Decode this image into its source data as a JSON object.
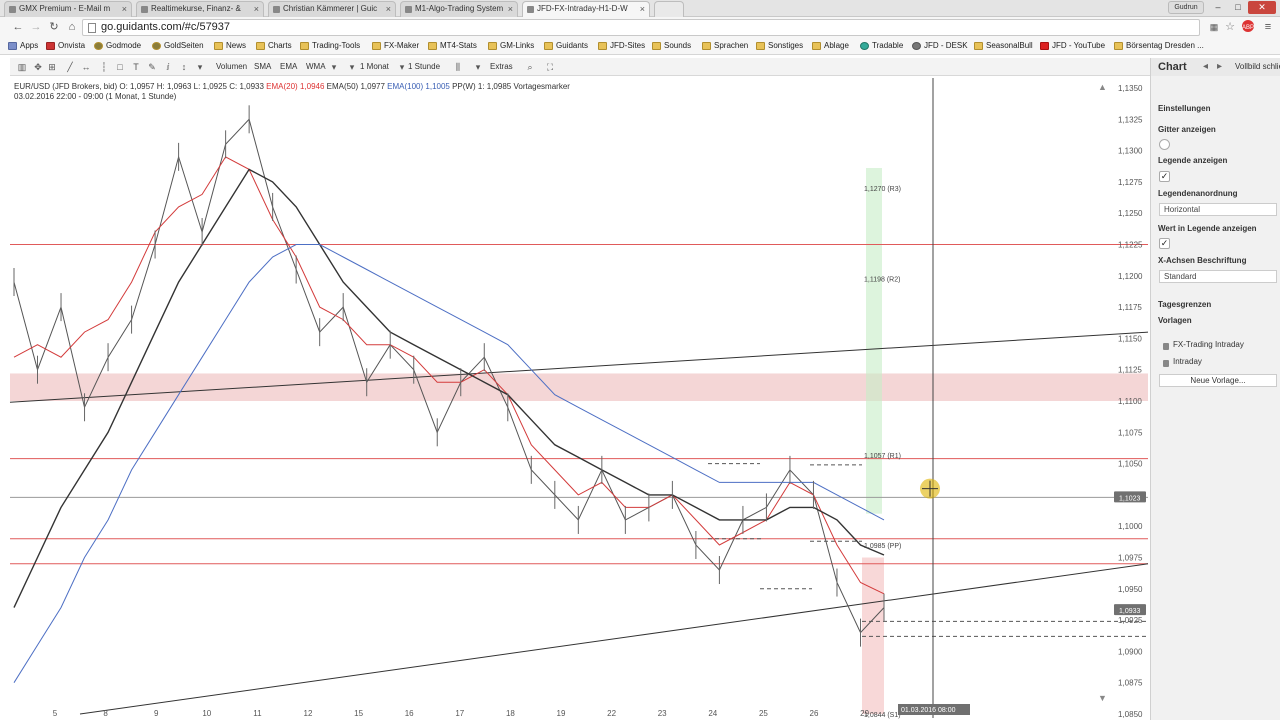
{
  "browser": {
    "tabs": [
      {
        "label": "GMX Premium - E-Mail m",
        "active": false
      },
      {
        "label": "Realtimekurse, Finanz- &",
        "active": false
      },
      {
        "label": "Christian Kämmerer | Guic",
        "active": false
      },
      {
        "label": "M1-Algo-Trading System",
        "active": false
      },
      {
        "label": "JFD-FX-Intraday-H1-D-W",
        "active": true
      }
    ],
    "profile_label": "Gudrun",
    "url": "go.guidants.com/#c/57937",
    "bookmarks": [
      "Apps",
      "Onvista",
      "Godmode",
      "GoldSeiten",
      "News",
      "Charts",
      "Trading-Tools",
      "FX-Maker",
      "MT4-Stats",
      "GM-Links",
      "Guidants",
      "JFD-Sites",
      "Sounds",
      "Sprachen",
      "Sonstiges",
      "Ablage",
      "Tradable",
      "JFD - DESK",
      "SeasonalBull",
      "JFD - YouTube",
      "Börsentag Dresden ..."
    ]
  },
  "toolbar": {
    "volumen": "Volumen",
    "sma": "SMA",
    "ema": "EMA",
    "wma": "WMA",
    "period": "1 Monat",
    "interval": "1 Stunde",
    "extras": "Extras"
  },
  "legend": {
    "instrument": "EUR/USD (JFD Brokers, bid)",
    "ohlc": "O: 1,0957  H: 1,0963  L: 1,0925  C: 1,0933",
    "ema20": "EMA(20)  1,0946",
    "ema50": "EMA(50)  1,0977",
    "ema100": "EMA(100)  1,1005",
    "pp": "PP(W)  1: 1,0985",
    "vorgabe": "Vortagesmarker",
    "range": "03.02.2016 22:00 - 09:00 (1 Monat, 1 Stunde)"
  },
  "chart_data": {
    "type": "line",
    "instrument": "EUR/USD",
    "y_axis": {
      "min": 1.085,
      "max": 1.135,
      "ticks": [
        "1,1350",
        "1,1325",
        "1,1300",
        "1,1275",
        "1,1250",
        "1,1225",
        "1,1200",
        "1,1175",
        "1,1150",
        "1,1125",
        "1,1100",
        "1,1075",
        "1,1050",
        "1,1025",
        "1,1000",
        "1,0975",
        "1,0950",
        "1,0925",
        "1,0900",
        "1,0875",
        "1,0850"
      ]
    },
    "x_ticks": [
      "5",
      "8",
      "9",
      "10",
      "11",
      "12",
      "15",
      "16",
      "17",
      "18",
      "19",
      "22",
      "23",
      "24",
      "25",
      "26",
      "29"
    ],
    "series": [
      {
        "values": [
          1.1195,
          1.1125,
          1.1175,
          1.1095,
          1.1135,
          1.1165,
          1.1225,
          1.1295,
          1.1235,
          1.1305,
          1.1325,
          1.1255,
          1.1205,
          1.1155,
          1.1175,
          1.1115,
          1.1145,
          1.1125,
          1.1075,
          1.1115,
          1.1135,
          1.1095,
          1.1045,
          1.1025,
          1.1005,
          1.1045,
          1.1005,
          1.1015,
          1.1025,
          1.0985,
          1.0965,
          1.1005,
          1.1015,
          1.1045,
          1.1025,
          1.0955,
          1.0915,
          1.0935
        ]
      },
      {
        "values": [
          1.1135,
          1.1145,
          1.1135,
          1.1155,
          1.1165,
          1.1195,
          1.1235,
          1.1255,
          1.1265,
          1.1295,
          1.1285,
          1.1245,
          1.1215,
          1.1175,
          1.1165,
          1.1145,
          1.1145,
          1.1135,
          1.1115,
          1.1115,
          1.1125,
          1.1105,
          1.1065,
          1.1045,
          1.1025,
          1.1035,
          1.1015,
          1.1015,
          1.1025,
          1.1005,
          1.0985,
          1.0995,
          1.1005,
          1.1035,
          1.1025,
          1.0985,
          1.0955,
          1.0946
        ]
      },
      {
        "values": [
          1.0935,
          1.0975,
          1.1015,
          1.1045,
          1.1075,
          1.1115,
          1.1155,
          1.1195,
          1.1225,
          1.1255,
          1.1285,
          1.1275,
          1.1255,
          1.1225,
          1.1195,
          1.1175,
          1.1155,
          1.1145,
          1.1135,
          1.1125,
          1.1115,
          1.1105,
          1.1085,
          1.1065,
          1.1055,
          1.1045,
          1.1035,
          1.1025,
          1.1025,
          1.1015,
          1.1005,
          1.1005,
          1.1005,
          1.1015,
          1.1015,
          1.1005,
          1.0985,
          1.0977
        ]
      },
      {
        "values": [
          1.0875,
          1.0905,
          1.0935,
          1.0975,
          1.1005,
          1.1045,
          1.1075,
          1.1105,
          1.1135,
          1.1165,
          1.1195,
          1.1215,
          1.1225,
          1.1225,
          1.1215,
          1.1205,
          1.1195,
          1.1185,
          1.1175,
          1.1165,
          1.1155,
          1.1145,
          1.1125,
          1.1105,
          1.1095,
          1.1085,
          1.1075,
          1.1065,
          1.1055,
          1.1045,
          1.1035,
          1.1035,
          1.1035,
          1.1035,
          1.1035,
          1.1025,
          1.1015,
          1.1005
        ]
      }
    ],
    "horizontal_levels": [
      {
        "value": 1.1225,
        "color": "#e05a5a"
      },
      {
        "value": 1.1054,
        "color": "#e05a5a"
      },
      {
        "value": 1.1023,
        "color": "#9a9a9a"
      },
      {
        "value": 1.099,
        "color": "#e05a5a"
      },
      {
        "value": 1.097,
        "color": "#e05a5a"
      }
    ],
    "zone": {
      "from": 1.11,
      "to": 1.1122,
      "color": "#f0c8c8"
    },
    "pivot_labels": [
      {
        "label": "1,1270 (R3)",
        "value": 1.127
      },
      {
        "label": "1,1198 (R2)",
        "value": 1.1198
      },
      {
        "label": "1,1057 (R1)",
        "value": 1.1057
      },
      {
        "label": "1,0985 (PP)",
        "value": 1.0985
      },
      {
        "label": "1,0844 (S1)",
        "value": 1.0844
      }
    ],
    "price_tags": [
      {
        "label": "1,1023",
        "value": 1.1023
      },
      {
        "label": "1,0933",
        "value": 1.0933
      }
    ],
    "crosshair_date": "01.03.2016 08:00"
  },
  "panel": {
    "title": "Chart",
    "settings": "Einstellungen",
    "grid": "Gitter anzeigen",
    "legend_show": "Legende anzeigen",
    "legend_order": "Legendenanordnung",
    "legend_order_value": "Horizontal",
    "legend_values": "Wert in Legende anzeigen",
    "xaxis": "X-Achsen Beschriftung",
    "xaxis_value": "Standard",
    "day_bounds": "Tagesgrenzen",
    "templates": "Vorlagen",
    "template_items": [
      "FX-Trading Intraday",
      "Intraday"
    ],
    "new_template": "Neue Vorlage...",
    "close_label": "Vollbild schließen"
  },
  "colors": {
    "ema20": "#d33b3b",
    "ema50": "#333333",
    "ema100": "#4d6fc4",
    "level": "#e05a5a",
    "zone": "#f0c8c8",
    "cross": "#e0b400"
  }
}
